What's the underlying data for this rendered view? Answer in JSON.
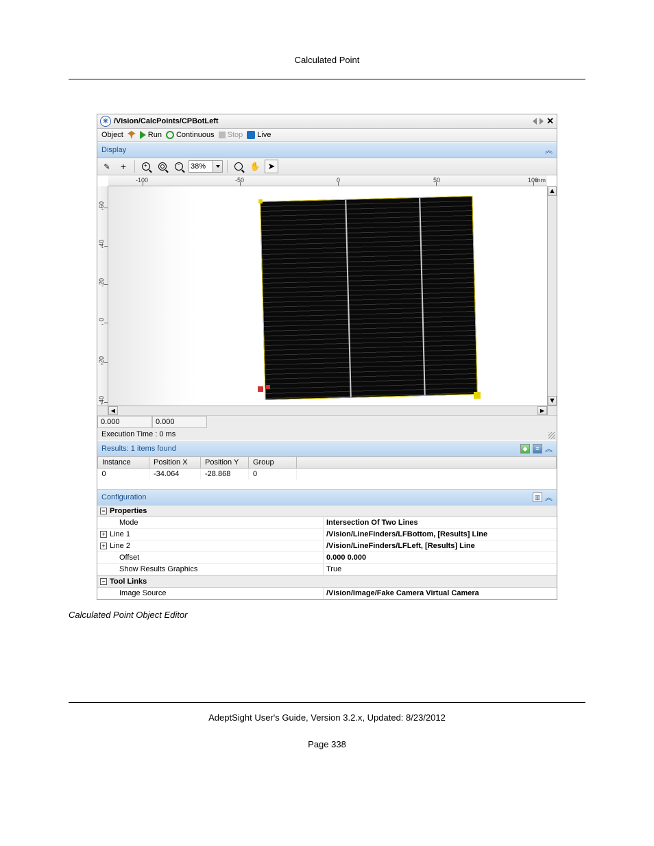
{
  "doc": {
    "header": "Calculated Point",
    "caption": "Calculated Point Object Editor",
    "footer": "AdeptSight User's Guide,  Version 3.2.x, Updated: 8/23/2012",
    "page": "Page 338"
  },
  "editor": {
    "title": "/Vision/CalcPoints/CPBotLeft",
    "toolbar1": {
      "object": "Object",
      "run": "Run",
      "continuous": "Continuous",
      "stop": "Stop",
      "live": "Live"
    },
    "display_label": "Display",
    "zoom_value": "38%",
    "ruler_x": {
      "m100": "-100",
      "m50": "-50",
      "zero": "0",
      "p50": "50",
      "p100": "100",
      "unit": "mm"
    },
    "ruler_y": {
      "p60": "60",
      "p40": "40",
      "p20": "20",
      "zero": "0",
      "m20": "-20",
      "m40": "-40"
    },
    "status_x": "0.000",
    "status_y": "0.000",
    "exec_time": "Execution Time : 0 ms",
    "results_label": "Results: 1 items found",
    "results": {
      "cols": {
        "instance": "Instance",
        "px": "Position X",
        "py": "Position Y",
        "group": "Group"
      },
      "rows": [
        {
          "instance": "0",
          "px": "-34.064",
          "py": "-28.868",
          "group": "0"
        }
      ]
    },
    "configuration_label": "Configuration",
    "prop": {
      "cat_properties": "Properties",
      "mode_k": "Mode",
      "mode_v": "Intersection Of Two Lines",
      "line1_k": "Line 1",
      "line1_v": "/Vision/LineFinders/LFBottom, [Results] Line",
      "line2_k": "Line 2",
      "line2_v": "/Vision/LineFinders/LFLeft, [Results] Line",
      "offset_k": "Offset",
      "offset_v": "0.000 0.000",
      "showres_k": "Show Results Graphics",
      "showres_v": "True",
      "cat_toollinks": "Tool Links",
      "imgsrc_k": "Image Source",
      "imgsrc_v": "/Vision/Image/Fake Camera Virtual Camera"
    }
  }
}
